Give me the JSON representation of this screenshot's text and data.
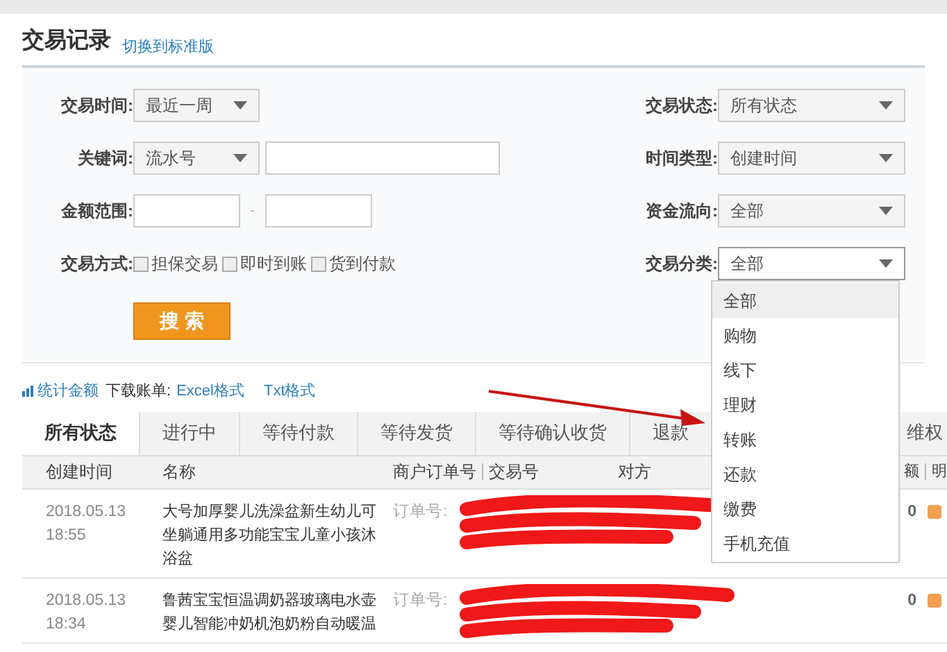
{
  "header": {
    "title": "交易记录",
    "switch_link": "切换到标准版"
  },
  "filters": {
    "left": [
      {
        "kind": "select",
        "label": "交易时间:",
        "value": "最近一周"
      },
      {
        "kind": "select_input",
        "label": "关键词:",
        "value": "流水号"
      },
      {
        "kind": "range",
        "label": "金额范围:",
        "separator": "-"
      },
      {
        "kind": "checks",
        "label": "交易方式:",
        "options": [
          {
            "label": "担保交易",
            "checked": false
          },
          {
            "label": "即时到账",
            "checked": false
          },
          {
            "label": "货到付款",
            "checked": false
          }
        ]
      }
    ],
    "right": [
      {
        "label": "交易状态:",
        "value": "所有状态",
        "open": false
      },
      {
        "label": "时间类型:",
        "value": "创建时间",
        "open": false
      },
      {
        "label": "资金流向:",
        "value": "全部",
        "open": false
      },
      {
        "label": "交易分类:",
        "value": "全部",
        "open": true
      }
    ],
    "search_button": "搜 索"
  },
  "dropdown": {
    "items": [
      {
        "label": "全部",
        "selected": true
      },
      {
        "label": "购物",
        "selected": false
      },
      {
        "label": "线下",
        "selected": false
      },
      {
        "label": "理财",
        "selected": false
      },
      {
        "label": "转账",
        "selected": false
      },
      {
        "label": "还款",
        "selected": false
      },
      {
        "label": "缴费",
        "selected": false
      },
      {
        "label": "手机充值",
        "selected": false
      }
    ]
  },
  "links": {
    "stats": "统计金额",
    "download_label": "下载账单:",
    "excel": "Excel格式",
    "txt": "Txt格式"
  },
  "tabs": [
    {
      "label": "所有状态",
      "selected": true
    },
    {
      "label": "进行中",
      "selected": false
    },
    {
      "label": "等待付款",
      "selected": false
    },
    {
      "label": "等待发货",
      "selected": false
    },
    {
      "label": "等待确认收货",
      "selected": false
    },
    {
      "label": "退款",
      "selected": false
    },
    {
      "label": "维权",
      "selected": false
    }
  ],
  "table": {
    "columns": [
      "创建时间",
      "名称",
      "商户订单号",
      "交易号",
      "对方",
      "额",
      "明"
    ],
    "rows": [
      {
        "date": "2018.05.13",
        "time": "18:55",
        "name": "大号加厚婴儿洗澡盆新生幼儿可坐躺通用多功能宝宝儿童小孩沐浴盆",
        "order": "订单号:",
        "amount": "0"
      },
      {
        "date": "2018.05.13",
        "time": "18:34",
        "name": "鲁茜宝宝恒温调奶器玻璃电水壶婴儿智能冲奶机泡奶粉自动暖温",
        "order": "订单号:",
        "amount": "0"
      }
    ]
  }
}
